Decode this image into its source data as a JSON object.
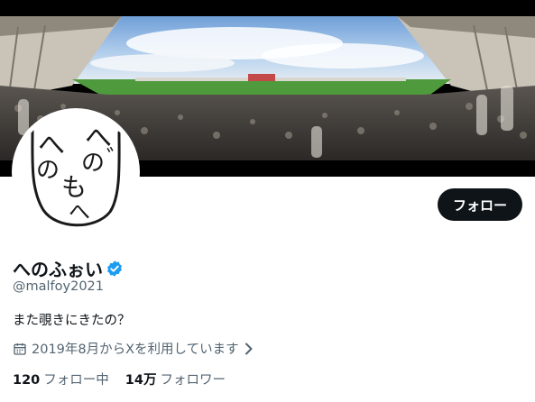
{
  "profile": {
    "display_name": "へのふぉい",
    "handle": "@malfoy2021",
    "bio": "また覗きにきたの？",
    "joined": "2019年8月からXを利用しています",
    "verified": true,
    "avatar_text": [
      "へ",
      "へ",
      "の",
      "の",
      "も",
      "へ",
      "゛"
    ]
  },
  "actions": {
    "follow_label": "フォロー"
  },
  "stats": {
    "following_count": "120",
    "following_label": "フォロー中",
    "followers_count": "14万",
    "followers_label": "フォロワー"
  },
  "colors": {
    "verified": "#1d9bf0",
    "button_bg": "#0f1419",
    "secondary_text": "#536471"
  },
  "icons": {
    "verified": "verified-badge-icon",
    "calendar": "calendar-icon",
    "chevron": "chevron-right-icon"
  }
}
